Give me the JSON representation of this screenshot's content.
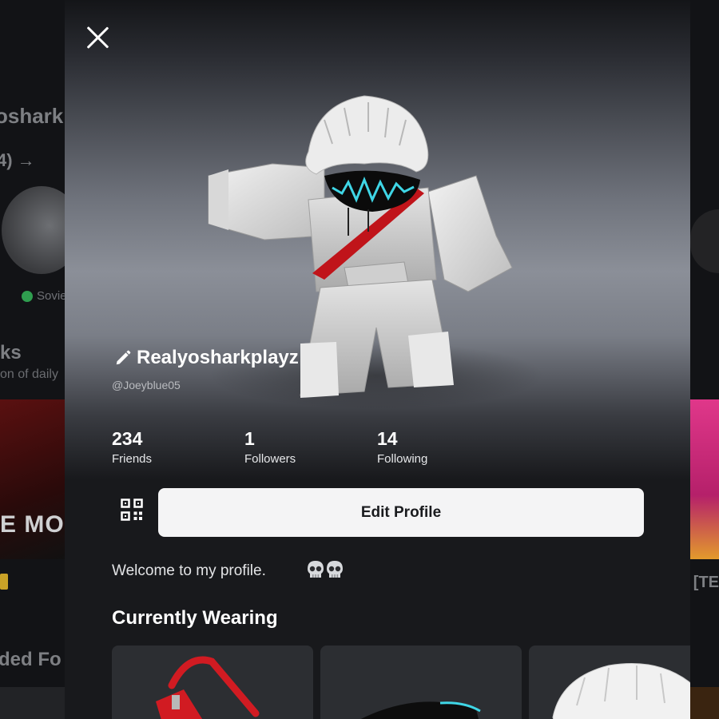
{
  "background": {
    "username_fragment": "osharkp",
    "friends_fragment": "4) →",
    "status_fragment": "Sovie",
    "section_fragment": "ks",
    "section_sub_fragment": "on of daily",
    "game_tile_text": "E MONOL",
    "right_text_fragment": ": [TE",
    "section2_fragment": "ded Fo"
  },
  "profile": {
    "display_name": "Realyosharkplayz",
    "handle": "@Joeyblue05",
    "stats": [
      {
        "value": "234",
        "label": "Friends"
      },
      {
        "value": "1",
        "label": "Followers"
      },
      {
        "value": "14",
        "label": "Following"
      }
    ],
    "edit_label": "Edit Profile",
    "bio": "Welcome to my profile."
  },
  "currently_wearing": {
    "title": "Currently Wearing"
  },
  "icons": {
    "close": "close-icon",
    "edit": "pencil-icon",
    "qr": "qr-code-icon",
    "skull": "skull-emoji"
  },
  "colors": {
    "modal_bg": "#18191c",
    "button_bg": "#f4f4f5",
    "accent_red": "#c0141a",
    "visor_cyan": "#3fd6e6",
    "online_green": "#2f9e4f"
  }
}
